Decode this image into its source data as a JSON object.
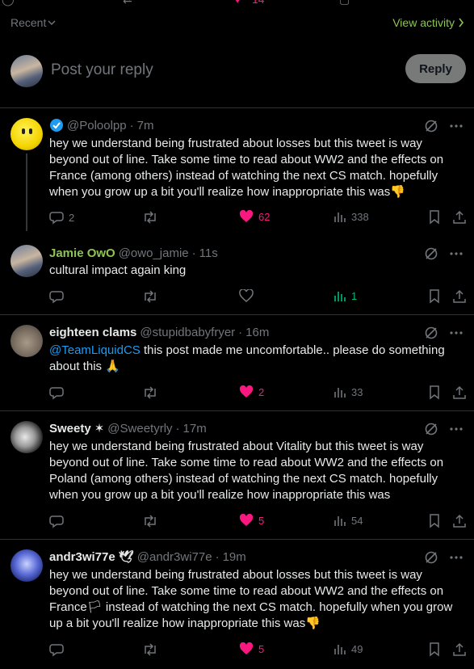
{
  "top_bar": {
    "likes_partial": "14"
  },
  "recent": {
    "label": "Recent"
  },
  "view_activity": {
    "label": "View activity"
  },
  "reply_box": {
    "placeholder": "Post your reply",
    "button_label": "Reply"
  },
  "tweets": [
    {
      "name": "",
      "handle": "@Poloolpp",
      "time": "7m",
      "verified": true,
      "body": "hey we understand being frustrated about losses but this tweet is way beyond out of line. Take some time to read about WW2 and the effects on France (among others) instead of watching the next CS match. hopefully when you grow up a bit you'll realize how inappropriate this was",
      "emoji": "👎",
      "replies": "2",
      "retweets": "",
      "likes": "62",
      "views": "338"
    },
    {
      "name": "Jamie OwO",
      "handle": "@owo_jamie",
      "time": "11s",
      "body": "cultural impact again king",
      "replies": "",
      "retweets": "",
      "likes": "",
      "views": "1"
    },
    {
      "name": "eighteen clams",
      "handle": "@stupidbabyfryer",
      "time": "16m",
      "mention": "@TeamLiquidCS",
      "body": " this post made me uncomfortable.. please do something about this",
      "emoji": "🙏",
      "replies": "",
      "retweets": "",
      "likes": "2",
      "views": "33"
    },
    {
      "name": "Sweety",
      "name_badge": "✶",
      "handle": "@Sweetyrly",
      "time": "17m",
      "body": "hey we understand being frustrated about Vitality but this tweet is way beyond out of line. Take some time to read about WW2 and the effects on Poland (among others) instead of watching the next CS match. hopefully when you grow up a bit you'll realize how inappropriate this was",
      "replies": "",
      "retweets": "",
      "likes": "5",
      "views": "54"
    },
    {
      "name": "andr3wi77e",
      "name_badge": "🕊",
      "handle": "@andr3wi77e",
      "time": "19m",
      "body_part1": "hey we understand being frustrated about losses but this tweet is way beyond out of line. Take some time to read about WW2 and the effects on France",
      "flag": "🏳",
      "body_part2": " instead of watching the next CS match. hopefully when you grow up a bit you'll realize how inappropriate this was",
      "emoji": "👎",
      "replies": "",
      "retweets": "",
      "likes": "5",
      "views": "49"
    }
  ],
  "separator": "·",
  "colors": {
    "background": "#000000",
    "text": "#e7e9ea",
    "muted": "#71767b",
    "accent_green": "#8ec356",
    "like_pink": "#f91880",
    "mention_blue": "#1d9bf0",
    "verified_blue": "#1d9bf0",
    "divider": "#2f3336"
  },
  "icons": [
    "reply-icon",
    "retweet-icon",
    "like-icon",
    "views-icon",
    "bookmark-icon",
    "share-icon",
    "grok-icon",
    "more-icon",
    "verified-icon",
    "chevron-down-icon",
    "chevron-right-icon"
  ]
}
